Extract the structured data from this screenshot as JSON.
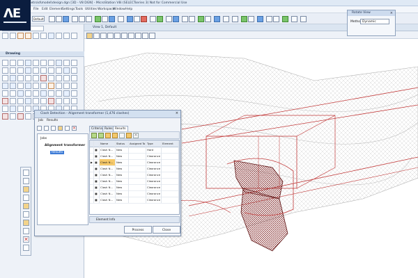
{
  "titlebar": {
    "text": "c:\\data\\drg\\metro\\d\\model\\design.dgn [3D - V8 DGN] - MicroStation V8i (SELECTseries 3) Not for Commercial Use"
  },
  "logo": {
    "text": "ΛE"
  },
  "menubar": {
    "items": [
      "File",
      "Edit",
      "Element",
      "Settings",
      "Tools",
      "Utilities",
      "Workspace",
      "Window",
      "Help"
    ]
  },
  "toolbar": {
    "level_label": "Default"
  },
  "leftpanel": {
    "search_text": "Drawing",
    "section_title": "Drawing"
  },
  "view": {
    "title": "View 1, Default"
  },
  "rotate_view": {
    "title": "Rotate View",
    "method_label": "Method:",
    "method_value": "Dynamic",
    "close": "×"
  },
  "dialog": {
    "title": "Clash Detection - Alignment transformer (1,476 clashes)",
    "close": "×",
    "menu": [
      "Job",
      "Results"
    ],
    "tree": {
      "root": "Jobs",
      "job": "Alignment transformer",
      "results": "Results"
    },
    "tabs": [
      "Criteria",
      "Rules",
      "Results"
    ],
    "columns": [
      "Name",
      "Status",
      "Assigned To",
      "Type",
      "Element"
    ],
    "rows": [
      {
        "name": "Clash N...",
        "status": "New",
        "assigned": "",
        "type": "Hard",
        "element": ""
      },
      {
        "name": "Clash N...",
        "status": "New",
        "assigned": "",
        "type": "Clearance",
        "element": ""
      },
      {
        "name": "Clash N...",
        "status": "New",
        "assigned": "",
        "type": "Clearance",
        "element": ""
      },
      {
        "name": "Clash N...",
        "status": "New",
        "assigned": "",
        "type": "Clearance",
        "element": ""
      },
      {
        "name": "Clash N...",
        "status": "New",
        "assigned": "",
        "type": "Clearance",
        "element": ""
      },
      {
        "name": "Clash N...",
        "status": "New",
        "assigned": "",
        "type": "Clearance",
        "element": ""
      },
      {
        "name": "Clash N...",
        "status": "New",
        "assigned": "",
        "type": "Clearance",
        "element": ""
      },
      {
        "name": "Clash N...",
        "status": "New",
        "assigned": "",
        "type": "Clearance",
        "element": ""
      },
      {
        "name": "Clash N...",
        "status": "New",
        "assigned": "",
        "type": "Clearance",
        "element": ""
      }
    ],
    "element_info": "Element Info",
    "process_btn": "Process",
    "close_btn": "Close"
  },
  "colors": {
    "clash_red": "#c23a3a",
    "mesh_gray": "#b9b9b9",
    "accent": "#3d7bd6"
  }
}
